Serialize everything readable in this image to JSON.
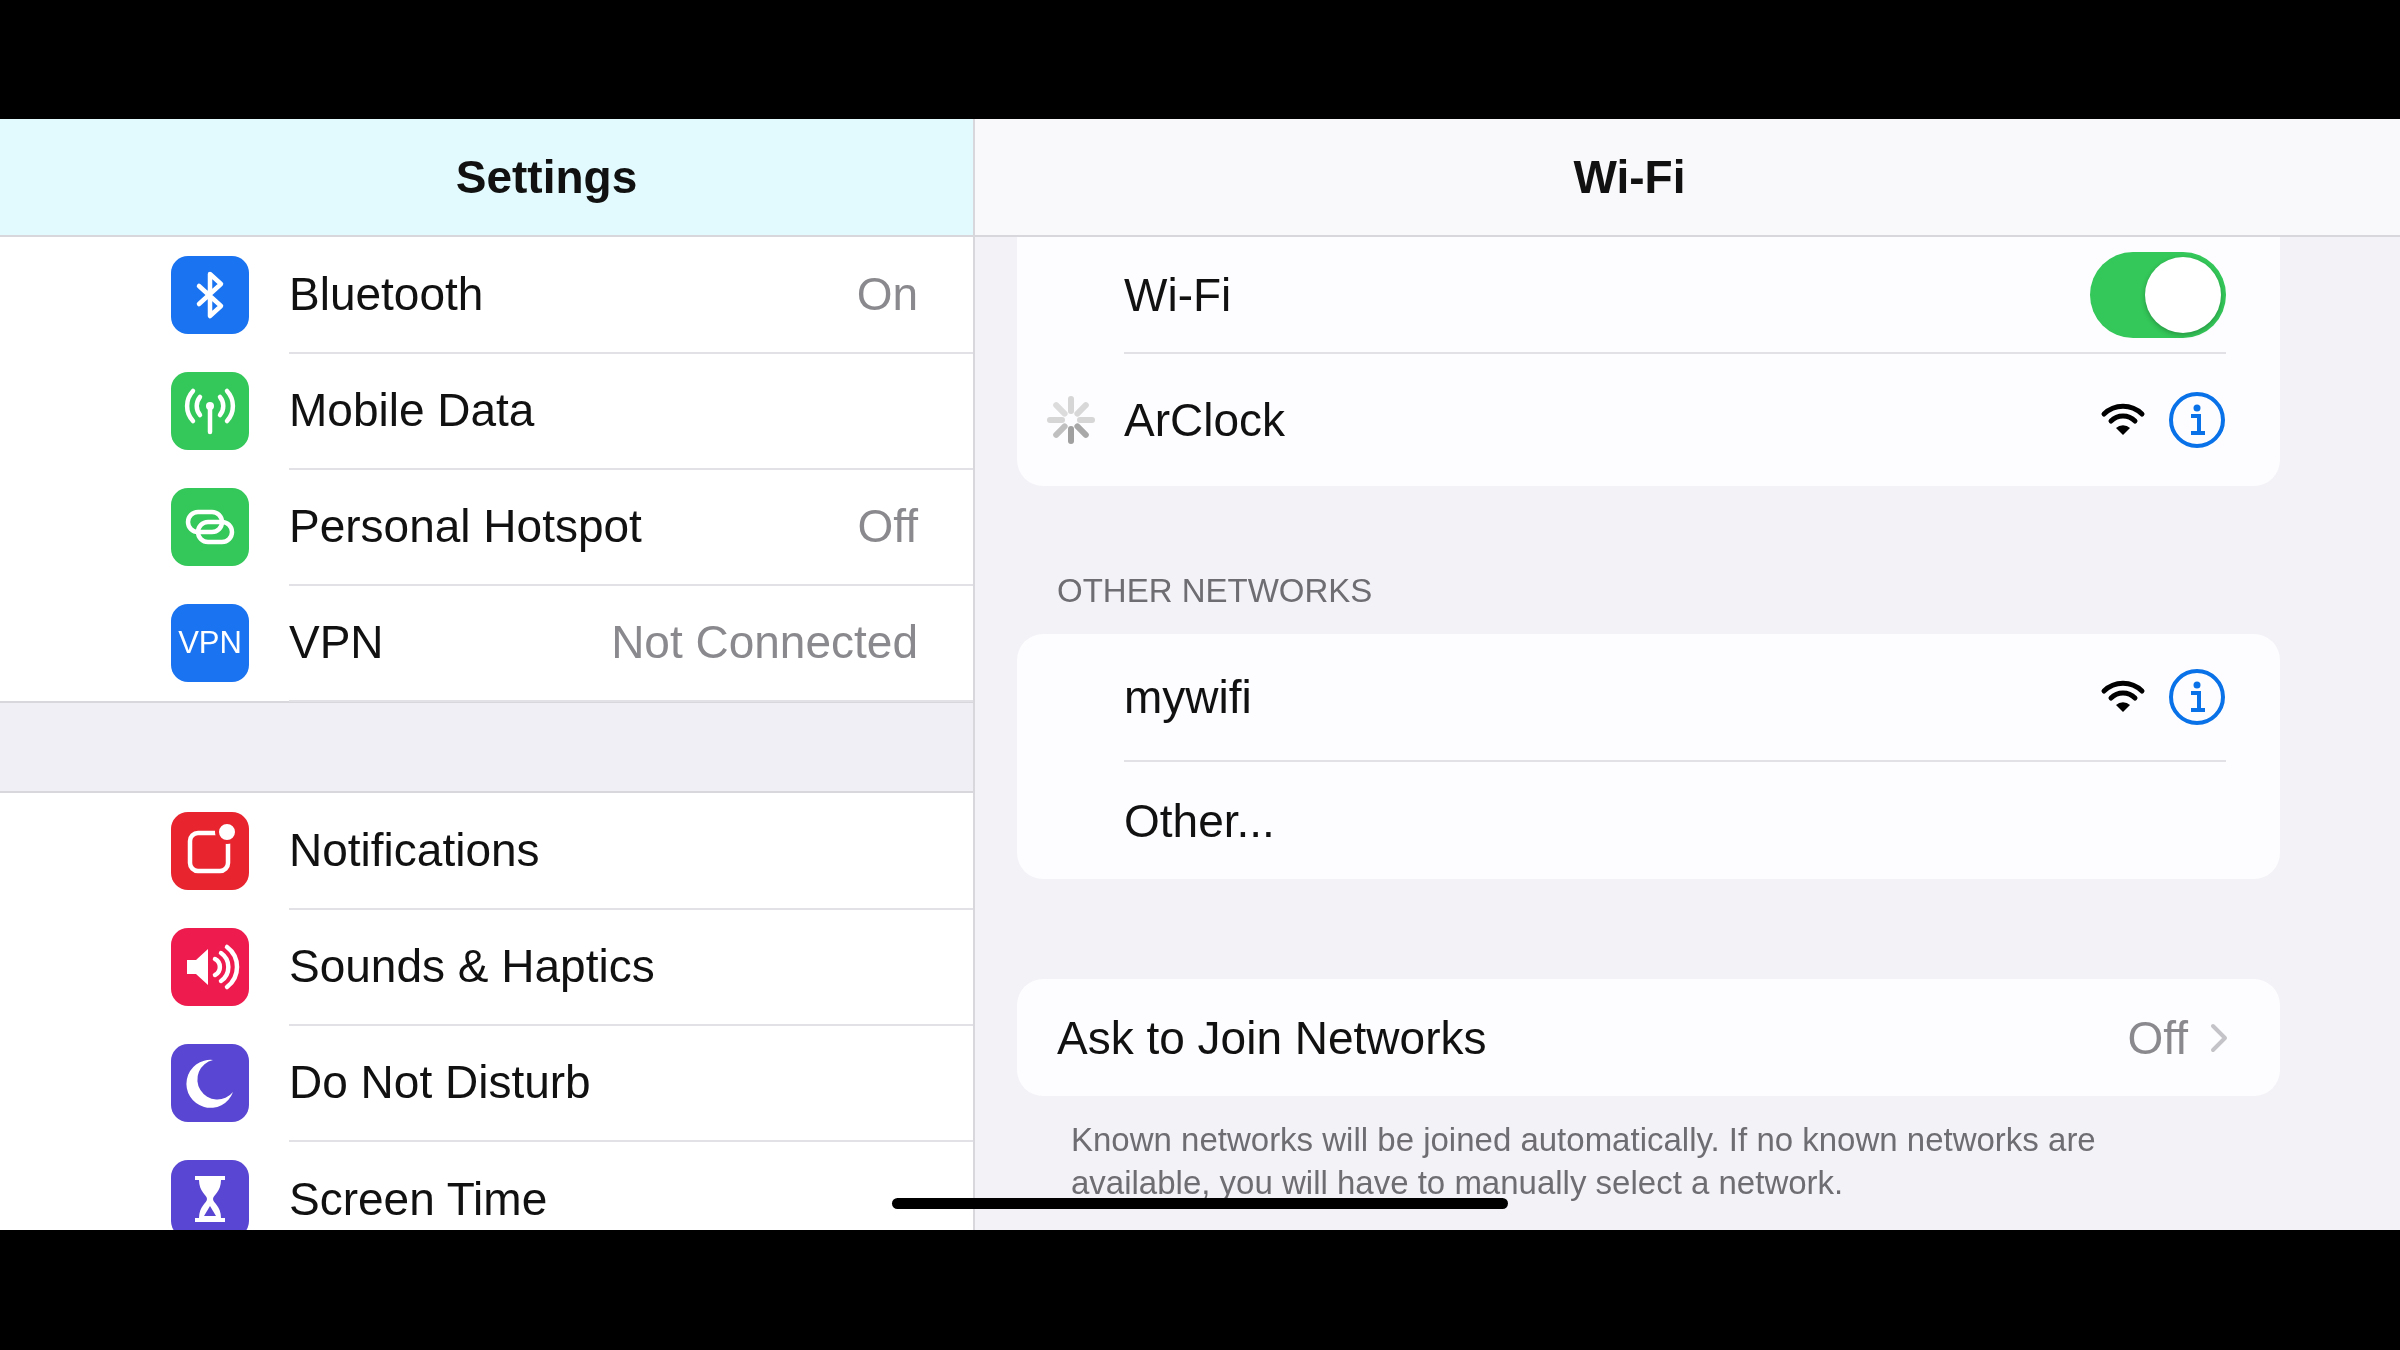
{
  "sidebar": {
    "title": "Settings",
    "groups": [
      [
        {
          "label": "Bluetooth",
          "value": "On"
        },
        {
          "label": "Mobile Data"
        },
        {
          "label": "Personal Hotspot",
          "value": "Off"
        },
        {
          "icon_text": "VPN",
          "label": "VPN",
          "value": "Not Connected"
        }
      ],
      [
        {
          "label": "Notifications"
        },
        {
          "label": "Sounds & Haptics"
        },
        {
          "label": "Do Not Disturb"
        },
        {
          "label": "Screen Time"
        }
      ]
    ]
  },
  "detail": {
    "title": "Wi-Fi",
    "wifi": {
      "label": "Wi-Fi",
      "on": true
    },
    "current_network": {
      "name": "ArClock",
      "connecting": true
    },
    "other_networks": {
      "header": "OTHER NETWORKS",
      "items": [
        {
          "kind": "network",
          "name": "mywifi"
        },
        {
          "kind": "other",
          "name": "Other..."
        }
      ]
    },
    "ask_to_join": {
      "label": "Ask to Join Networks",
      "value": "Off"
    },
    "footer": "Known networks will be joined automatically. If no known networks are available, you will have to manually select a network."
  }
}
